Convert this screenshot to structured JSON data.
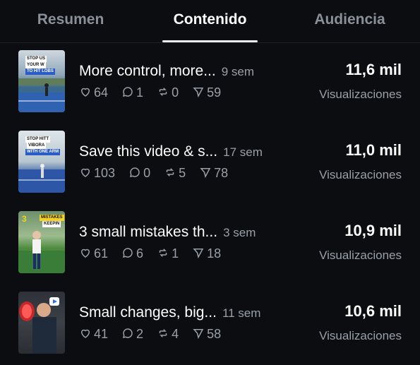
{
  "tabs": [
    {
      "label": "Resumen"
    },
    {
      "label": "Contenido"
    },
    {
      "label": "Audiencia"
    }
  ],
  "active_tab": "Contenido",
  "posts": [
    {
      "title": "More control, more...",
      "age": "9 sem",
      "likes": "64",
      "replies": "1",
      "reposts": "0",
      "saves": "59",
      "views": "11,6 mil",
      "views_label": "Visualizaciones",
      "thumb_text": [
        "STOP US",
        "YOUR W",
        "TO HIT LOBS"
      ]
    },
    {
      "title": "Save this video & s...",
      "age": "17 sem",
      "likes": "103",
      "replies": "0",
      "reposts": "5",
      "saves": "78",
      "views": "11,0 mil",
      "views_label": "Visualizaciones",
      "thumb_text": [
        "STOP HITT",
        "VIBORA",
        "WITH ONE ARM"
      ]
    },
    {
      "title": "3 small mistakes th...",
      "age": "3 sem",
      "likes": "61",
      "replies": "6",
      "reposts": "1",
      "saves": "18",
      "views": "10,9 mil",
      "views_label": "Visualizaciones",
      "thumb_text": [
        "3",
        "MISTAKES",
        "KEEPIN"
      ]
    },
    {
      "title": "Small changes, big...",
      "age": "11 sem",
      "likes": "41",
      "replies": "2",
      "reposts": "4",
      "saves": "58",
      "views": "10,6 mil",
      "views_label": "Visualizaciones",
      "thumb_text": []
    }
  ],
  "colors": {
    "background": "#0b0d10",
    "muted_text": "#9aa0a8",
    "tab_inactive": "#8b9098"
  }
}
